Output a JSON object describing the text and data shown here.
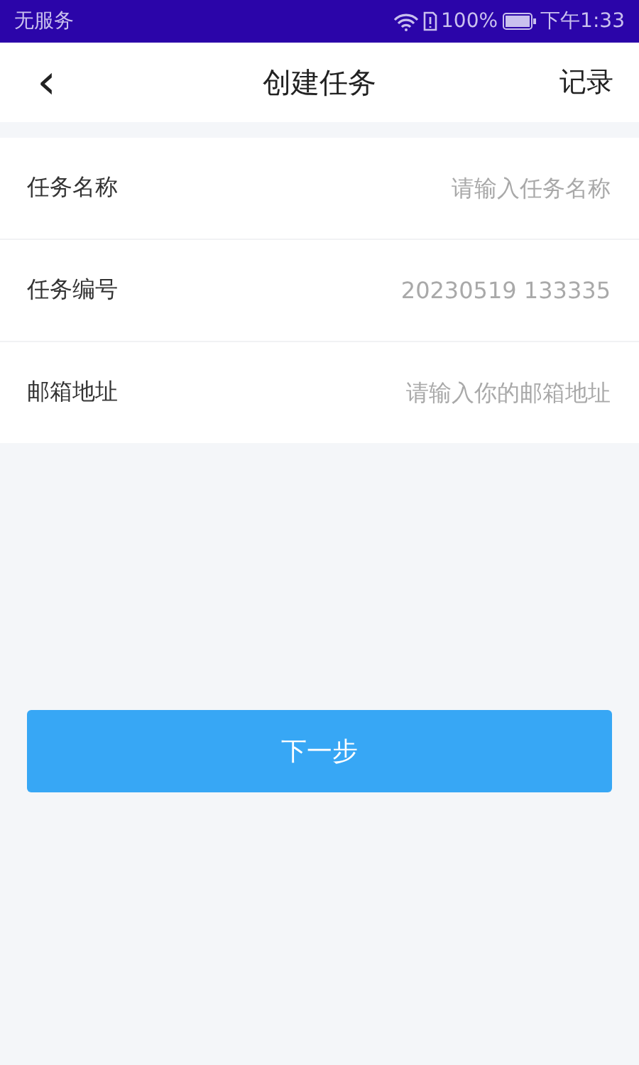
{
  "status_bar": {
    "carrier": "无服务",
    "battery": "100%",
    "time": "下午1:33"
  },
  "header": {
    "back": "‹",
    "title": "创建任务",
    "action": "记录"
  },
  "fields": [
    {
      "label": "任务名称",
      "placeholder": "请输入任务名称"
    },
    {
      "label": "任务编号",
      "value": "20230519 133335"
    },
    {
      "label": "邮箱地址",
      "placeholder": "请输入你的邮箱地址"
    }
  ],
  "button": "下一步"
}
